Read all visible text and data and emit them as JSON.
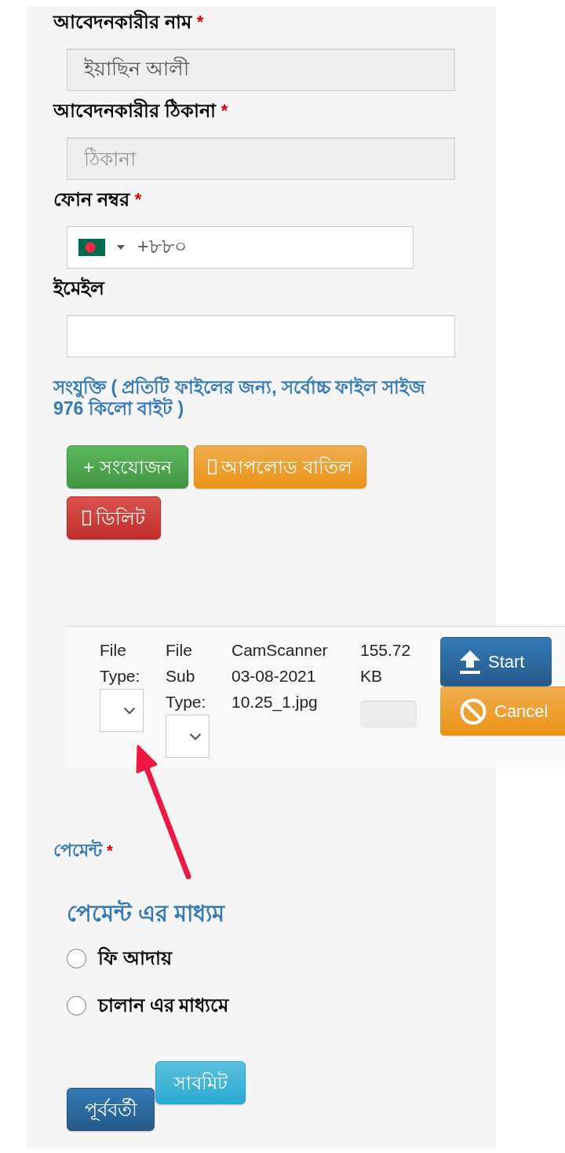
{
  "fields": [
    {
      "kind": "text",
      "label": "আবেদনকারীর নাম",
      "required_mark": "*",
      "value": "ইয়াছিন আলী",
      "disabled": true
    },
    {
      "kind": "text",
      "label": "আবেদনকারীর ঠিকানা",
      "required_mark": "*",
      "placeholder": "ঠিকানা",
      "disabled": true
    },
    {
      "kind": "phone",
      "label": "ফোন নম্বর",
      "required_mark": "*",
      "value": "+৮৮০",
      "disabled": false
    },
    {
      "kind": "text",
      "label": "ইমেইল",
      "disabled": false
    }
  ],
  "attachments": {
    "note": "সংযুক্তি ( প্রতিটি ফাইলের জন্য, সর্বোচ্চ ফাইল সাইজ 976 কিলো বাইট )",
    "buttons": [
      {
        "kind": "add",
        "label": "+ সংযোজন"
      },
      {
        "kind": "cancel",
        "label": "আপলোড বাতিল"
      },
      {
        "kind": "delete",
        "label": "ডিলিট"
      }
    ],
    "files": [
      {
        "type_label": "File Type:",
        "subtype_label": "File Sub Type:",
        "name": "CamScanner 03-08-2021 10.25_1.jpg",
        "size": "155.72 KB",
        "level": 0,
        "buttons": [
          {
            "kind": "start",
            "label": "Start"
          },
          {
            "kind": "cancel",
            "label": "Cancel"
          }
        ]
      }
    ]
  },
  "payment": {
    "label": "পেমেন্ট",
    "required_mark": "*",
    "heading": "পেমেন্ট এর মাধ্যম",
    "options": [
      {
        "label": "ফি আদায়",
        "selected": false
      },
      {
        "label": "চালান এর মাধ্যমে",
        "selected": false
      }
    ]
  },
  "buttons": [
    {
      "kind": "previous",
      "label": "পূর্ববর্তী"
    },
    {
      "kind": "submit",
      "label": "সাবমিট"
    }
  ]
}
